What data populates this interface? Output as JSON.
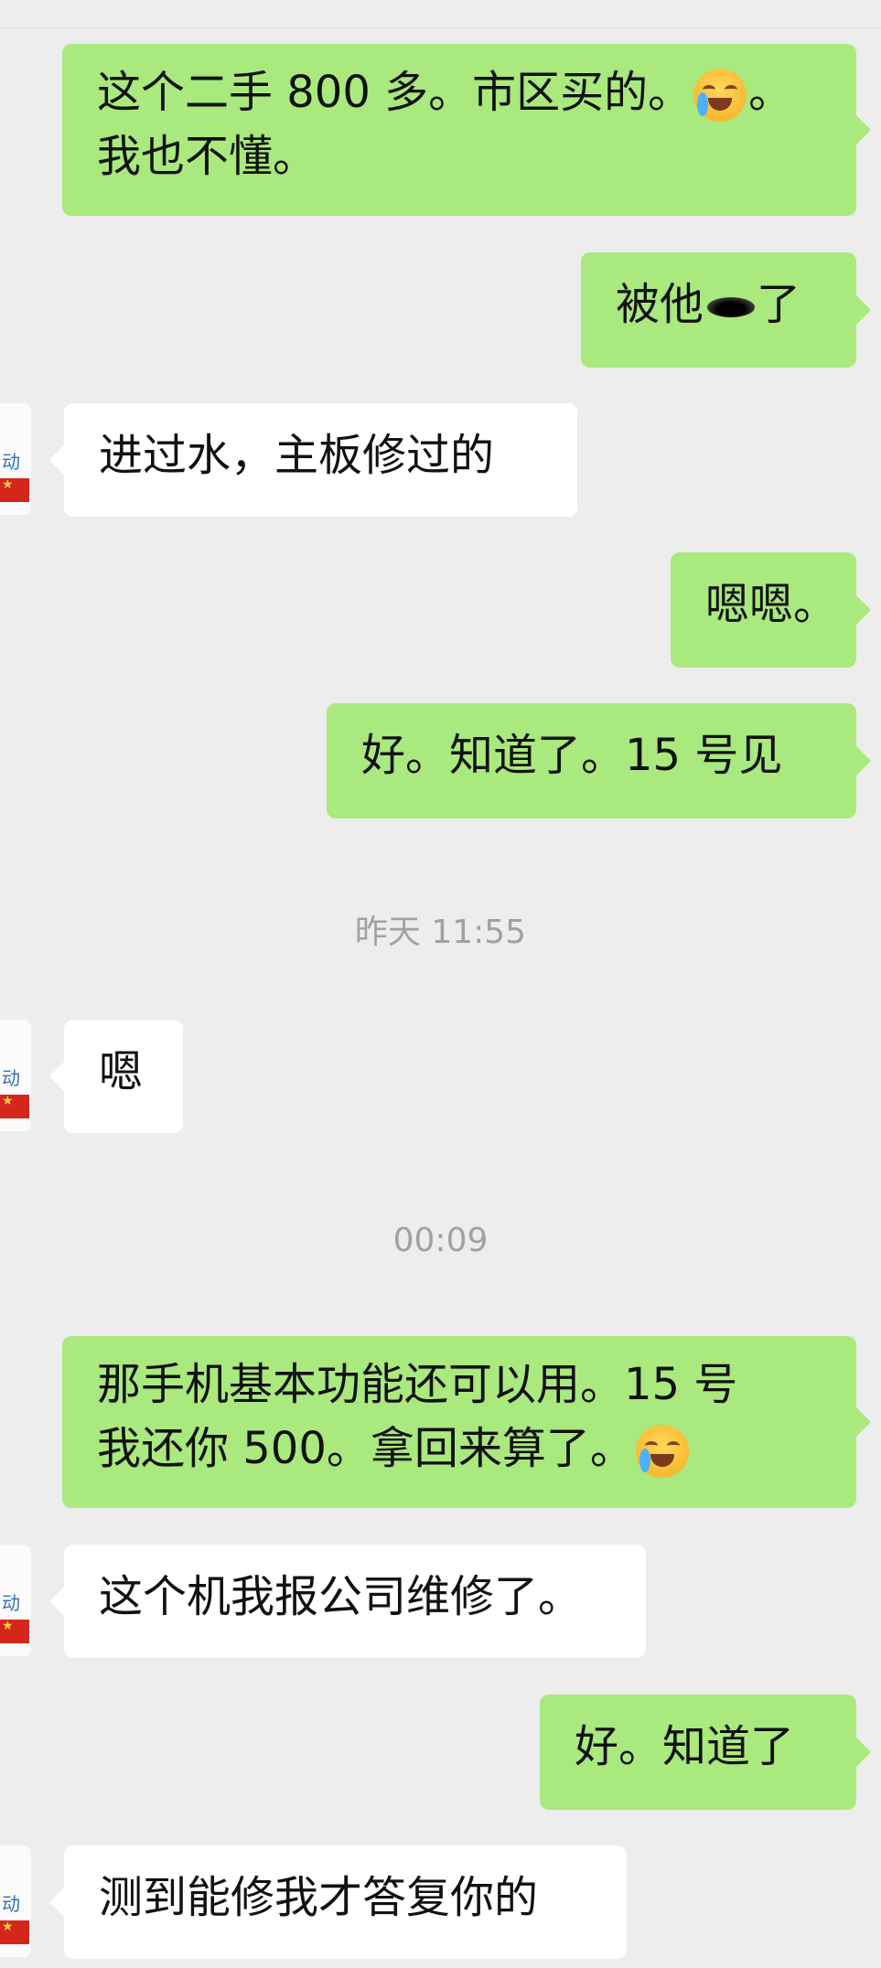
{
  "messages": [
    {
      "lines": [
        "这个二手 800 多。市区买的。",
        "。"
      ],
      "line2": "我也不懂。"
    },
    {
      "before": "被他",
      "after": "了"
    },
    {
      "text": "进过水，主板修过的"
    },
    {
      "text": "嗯嗯。"
    },
    {
      "text": "好。知道了。15 号见"
    },
    {
      "text": "嗯"
    },
    {
      "line1": "那手机基本功能还可以用。15 号",
      "line2": "我还你 500。拿回来算了。"
    },
    {
      "text": "这个机我报公司维修了。"
    },
    {
      "text": "好。知道了"
    },
    {
      "text": "测到能修我才答复你的"
    }
  ],
  "timestamps": [
    "昨天 11:55",
    "00:09"
  ],
  "avatar_text": "动",
  "icons": {
    "emoji": "tears-of-joy-emoji",
    "hole": "hole-emoji"
  },
  "colors": {
    "sent": "#a9e97d",
    "received": "#ffffff",
    "background": "#ededed",
    "timestamp": "#a1a1a1"
  }
}
